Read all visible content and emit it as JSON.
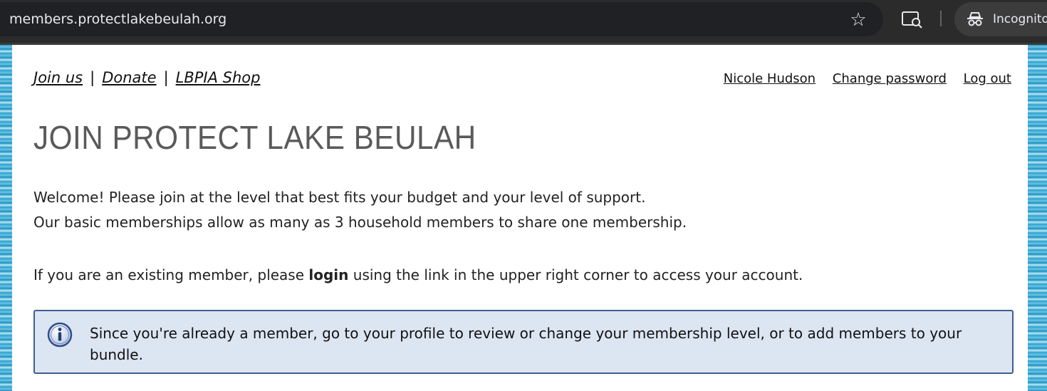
{
  "browser": {
    "url": "members.protectlakebeulah.org",
    "incognito_label": "Incognito"
  },
  "topnav": {
    "join": "Join us",
    "sep1": "|",
    "donate": "Donate",
    "sep2": "|",
    "shop": "LBPIA Shop"
  },
  "usernav": {
    "name": "Nicole Hudson",
    "change_password": "Change password",
    "logout": "Log out"
  },
  "title": "JOIN PROTECT LAKE BEULAH",
  "intro": {
    "line1": "Welcome! Please join at the level that best fits your budget and your level of support.",
    "line2": "Our basic memberships allow as many as 3 household members to share one membership."
  },
  "existing": {
    "before": "If you are an existing member, please ",
    "bold": "login",
    "after": " using the link in the upper right corner to access your account."
  },
  "notice": {
    "icon": "info-icon",
    "text": "Since you're already a member, go to your profile to review or change your membership level, or to add members to your bundle."
  }
}
